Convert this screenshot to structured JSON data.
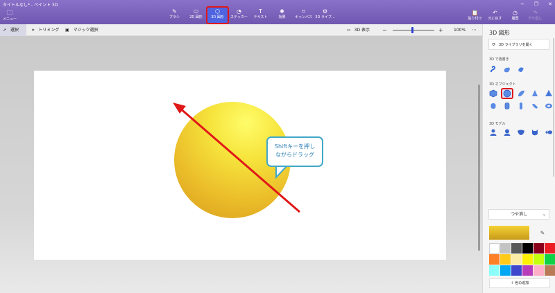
{
  "window": {
    "title": "タイトルなし* - ペイント 3D",
    "controls": [
      "−",
      "❐",
      "✕"
    ]
  },
  "toolbar": {
    "menu_label": "メニュー",
    "tools": [
      {
        "label": "ブラシ",
        "icon": "brush-icon",
        "glyph": "✎"
      },
      {
        "label": "2D 図形",
        "icon": "2d-shapes-icon",
        "glyph": "⬭"
      },
      {
        "label": "3D 図形",
        "icon": "3d-shapes-icon",
        "glyph": "⬡",
        "active": true
      },
      {
        "label": "ステッカー",
        "icon": "stickers-icon",
        "glyph": "◔"
      },
      {
        "label": "テキスト",
        "icon": "text-icon",
        "glyph": "T"
      },
      {
        "label": "効果",
        "icon": "effects-icon",
        "glyph": "✺"
      },
      {
        "label": "キャンバス",
        "icon": "canvas-icon",
        "glyph": "⌗"
      },
      {
        "label": "3D ライブ...",
        "icon": "3d-library-icon",
        "glyph": "⚙"
      }
    ],
    "right": [
      {
        "label": "貼り付け",
        "icon": "paste-icon",
        "glyph": "📋"
      },
      {
        "label": "元に戻す",
        "icon": "undo-icon",
        "glyph": "↶"
      },
      {
        "label": "履歴",
        "icon": "history-icon",
        "glyph": "◷"
      },
      {
        "label": "やり直し",
        "icon": "redo-icon",
        "glyph": "↷",
        "disabled": true
      }
    ]
  },
  "subbar": {
    "select": "選択",
    "trim": "トリミング",
    "magic_select": "マジック選択",
    "view3d": "3D 表示",
    "zoom": {
      "value": "100%",
      "level": 0.45
    }
  },
  "canvas": {
    "callout_line1": "Shiftキーを押し",
    "callout_line2": "ながらドラッグ",
    "accent": "#e01818"
  },
  "panel": {
    "title": "3D 図形",
    "library_button": "3D ライブラリを開く",
    "doodle_label": "3D で落書き",
    "objects_label": "3D オブジェクト",
    "models_label": "3D モデル",
    "finish": "つや消し",
    "add_color": "＋ 色の追加",
    "palette": [
      "#ffffff",
      "#c3c3c3",
      "#585858",
      "#000000",
      "#88001b",
      "#ec1c24",
      "#ff7f27",
      "#ffca18",
      "#fdeca6",
      "#fff200",
      "#c4ff0e",
      "#0ed145",
      "#8cfffb",
      "#00a8f3",
      "#3f48cc",
      "#b83dba",
      "#ffaec8",
      "#b97a56"
    ]
  }
}
